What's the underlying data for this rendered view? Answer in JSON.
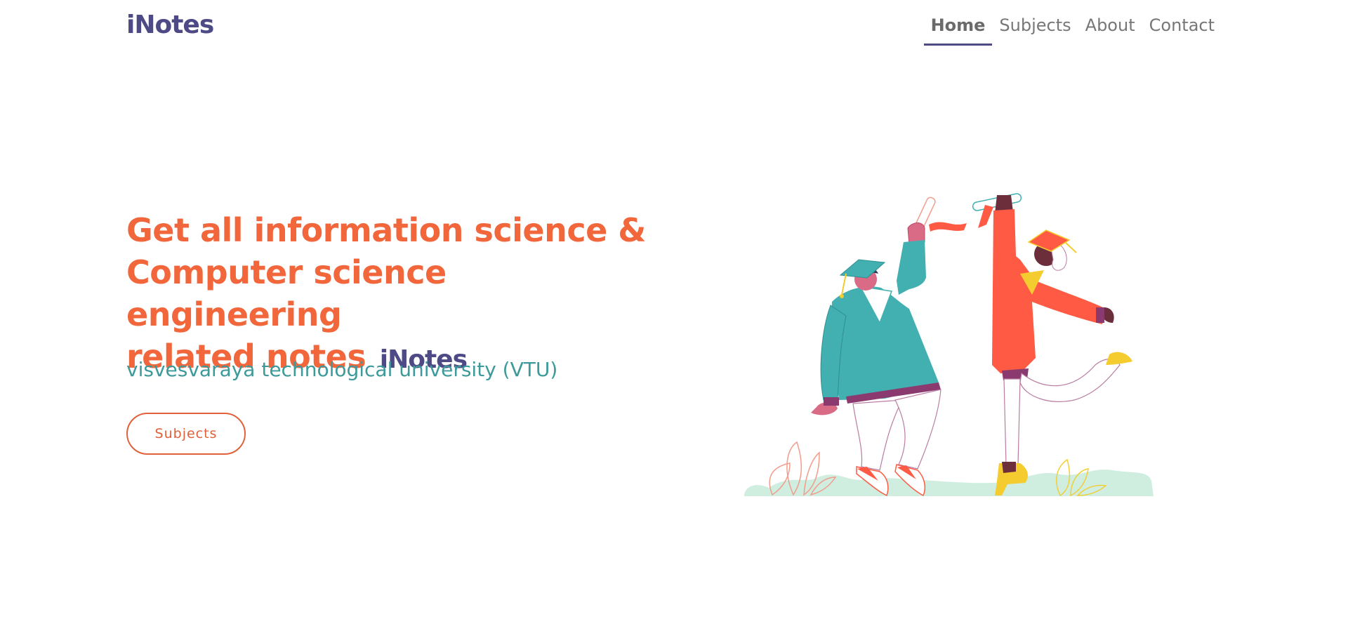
{
  "header": {
    "brand": "iNotes",
    "nav": [
      {
        "label": "Home",
        "active": true
      },
      {
        "label": "Subjects",
        "active": false
      },
      {
        "label": "About",
        "active": false
      },
      {
        "label": "Contact",
        "active": false
      }
    ]
  },
  "hero": {
    "title_line1": "Get all information science &",
    "title_line2": "Computer science engineering",
    "title_line3": "related notes",
    "title_brand": "iNotes",
    "subtitle": "visvesvaraya technological university (VTU)",
    "button_label": "Subjects"
  },
  "illustration": {
    "description_icon": "graduation-celebration-illustration"
  },
  "colors": {
    "brand": "#4e4a85",
    "accent": "#f2663c",
    "subtitle": "#3e9a9a",
    "teal_gown": "#42b0b0",
    "red_gown": "#ff5a43",
    "yellow": "#f5cc2f",
    "grass": "#cfeee0"
  }
}
